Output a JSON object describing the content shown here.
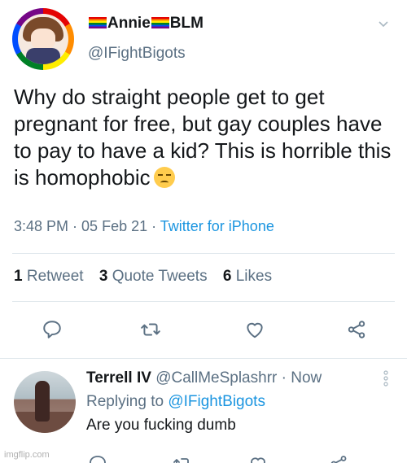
{
  "tweet": {
    "display_name_prefix_icon": "rainbow-flag",
    "display_name_part1": "Annie",
    "display_name_part2": "BLM",
    "handle": "@IFightBigots",
    "text": "Why do straight people get to get pregnant for free, but gay couples have to pay to have a kid? This is horrible this is homophobic",
    "emoji": "pensive-face",
    "time": "3:48 PM",
    "date": "05 Feb 21",
    "source": "Twitter for iPhone"
  },
  "stats": {
    "retweets_count": "1",
    "retweets_label": "Retweet",
    "quote_count": "3",
    "quote_label": "Quote Tweets",
    "likes_count": "6",
    "likes_label": "Likes"
  },
  "actions": [
    "reply-icon",
    "retweet-icon",
    "like-icon",
    "share-icon"
  ],
  "reply": {
    "name": "Terrell IV",
    "handle": "@CallMeSplashrr",
    "time": "Now",
    "replying_prefix": "Replying to",
    "replying_to": "@IFightBigots",
    "text": "Are you fucking dumb"
  },
  "watermark": "imgflip.com",
  "colors": {
    "link": "#1b95e0",
    "secondary_text": "#5b7083",
    "primary_text": "#14171a",
    "divider": "#e1e8ed"
  }
}
